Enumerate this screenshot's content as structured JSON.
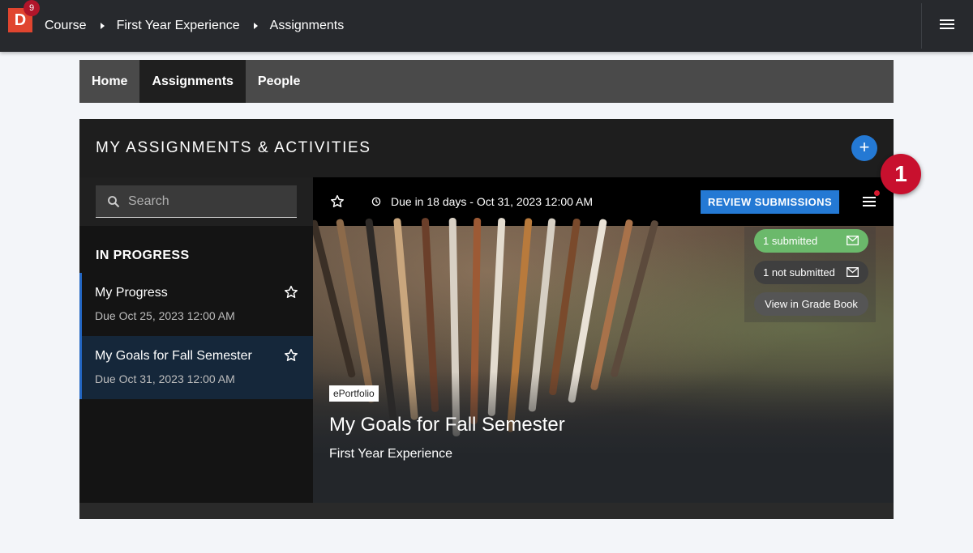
{
  "app": {
    "logo_letter": "D",
    "notification_count": "9"
  },
  "breadcrumb": [
    "Course",
    "First Year Experience",
    "Assignments"
  ],
  "tabs": [
    "Home",
    "Assignments",
    "People"
  ],
  "active_tab": "Assignments",
  "panel": {
    "title": "MY ASSIGNMENTS & ACTIVITIES",
    "add_label": "+"
  },
  "search": {
    "placeholder": "Search",
    "value": ""
  },
  "section_label": "IN PROGRESS",
  "assignments": [
    {
      "title": "My Progress",
      "due": "Due Oct 25, 2023 12:00 AM",
      "selected": false
    },
    {
      "title": "My Goals for Fall Semester",
      "due": "Due Oct 31, 2023 12:00 AM",
      "selected": true
    }
  ],
  "detail": {
    "due_text": "Due in 18 days - Oct 31, 2023 12:00 AM",
    "review_label": "REVIEW SUBMISSIONS",
    "submitted": "1 submitted",
    "not_submitted": "1 not submitted",
    "gradebook": "View in Grade Book",
    "type_tag": "ePortfolio",
    "title": "My Goals for Fall Semester",
    "course": "First Year Experience"
  },
  "callout_number": "1",
  "icons": {
    "menu": "hamburger-icon",
    "search": "search-icon",
    "star": "star-outline-icon",
    "clock": "clock-icon",
    "mail": "mail-icon",
    "notification_dot": "notification-dot-icon"
  },
  "colors": {
    "brand": "#e0452f",
    "accent": "#2479d4",
    "submitted": "#6bb96b",
    "callout": "#c8102e",
    "selection_border": "#2366c2"
  }
}
